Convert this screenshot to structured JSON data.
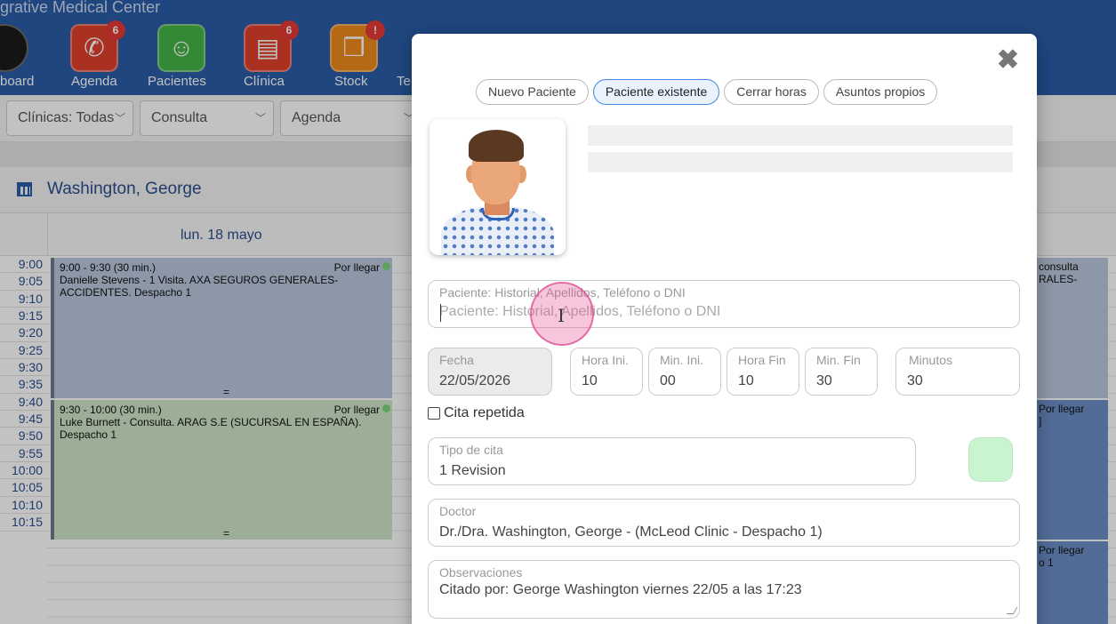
{
  "app": {
    "brand_fragment": "grative Medical Center",
    "nav": [
      {
        "label": "board",
        "icon": "dashboard-gauge-icon",
        "color": "#1b1b1b",
        "badge": ""
      },
      {
        "label": "Agenda",
        "icon": "phone-icon",
        "color": "#e0402c",
        "badge": "6"
      },
      {
        "label": "Pacientes",
        "icon": "person-icon",
        "color": "#45b549",
        "badge": ""
      },
      {
        "label": "Clínica",
        "icon": "clipboard-icon",
        "color": "#e0402c",
        "badge": "6"
      },
      {
        "label": "Stock",
        "icon": "box-icon",
        "color": "#f08a1c",
        "badge": "!"
      },
      {
        "label": "Te",
        "icon": "",
        "color": "#45b549",
        "badge": ""
      }
    ]
  },
  "filters": {
    "clinicas": "Clínicas: Todas",
    "tipo": "Consulta",
    "vista": "Agenda"
  },
  "calendar": {
    "doctor": "Washington, George",
    "day": "lun. 18 mayo",
    "times": [
      "9:00",
      "9:05",
      "9:10",
      "9:15",
      "9:20",
      "9:25",
      "9:30",
      "9:35",
      "9:40",
      "9:45",
      "9:50",
      "9:55",
      "10:00",
      "10:05",
      "10:10",
      "10:15"
    ],
    "appointments": [
      {
        "time": "9:00 - 9:30 (30 min.)",
        "status": "Por llegar",
        "text": "Danielle Stevens - 1 Visita. AXA SEGUROS GENERALES-ACCIDENTES. Despacho 1",
        "color": "#b8c7dc"
      },
      {
        "time": "9:30 - 10:00 (30 min.)",
        "status": "Por llegar",
        "text": "Luke Burnett - Consulta. ARAG S.E (SUCURSAL EN ESPAÑA). Despacho 1",
        "color": "#cde5c7"
      }
    ],
    "right_fragments": {
      "a": "consulta",
      "b": "RALES-",
      "c": "Por llegar",
      "d": "]",
      "e": "Por llegar",
      "f": "o 1"
    }
  },
  "modal": {
    "tabs": [
      {
        "label": "Nuevo Paciente",
        "active": false
      },
      {
        "label": "Paciente existente",
        "active": true
      },
      {
        "label": "Cerrar horas",
        "active": false
      },
      {
        "label": "Asuntos propios",
        "active": false
      }
    ],
    "patient_search": {
      "label": "Paciente: Historial, Apellidos, Teléfono o DNI",
      "placeholder": "Paciente: Historial, Apellidos, Teléfono o DNI",
      "value": ""
    },
    "fecha": {
      "label": "Fecha",
      "value": "22/05/2026"
    },
    "hora_ini": {
      "label": "Hora Ini.",
      "value": "10"
    },
    "min_ini": {
      "label": "Min. Ini.",
      "value": "00"
    },
    "hora_fin": {
      "label": "Hora Fin",
      "value": "10"
    },
    "min_fin": {
      "label": "Min. Fin",
      "value": "30"
    },
    "minutos": {
      "label": "Minutos",
      "value": "30"
    },
    "cita_repetida": {
      "label": "Cita repetida",
      "checked": false
    },
    "tipo_cita": {
      "label": "Tipo de cita",
      "value": "1 Revision",
      "color": "#c8f5cf"
    },
    "doctor": {
      "label": "Doctor",
      "value": "Dr./Dra. Washington, George - (McLeod Clinic - Despacho 1)"
    },
    "observaciones": {
      "label": "Observaciones",
      "value": "Citado por: George Washington viernes 22/05 a las 17:23"
    },
    "close_icon": "close-x-icon"
  }
}
